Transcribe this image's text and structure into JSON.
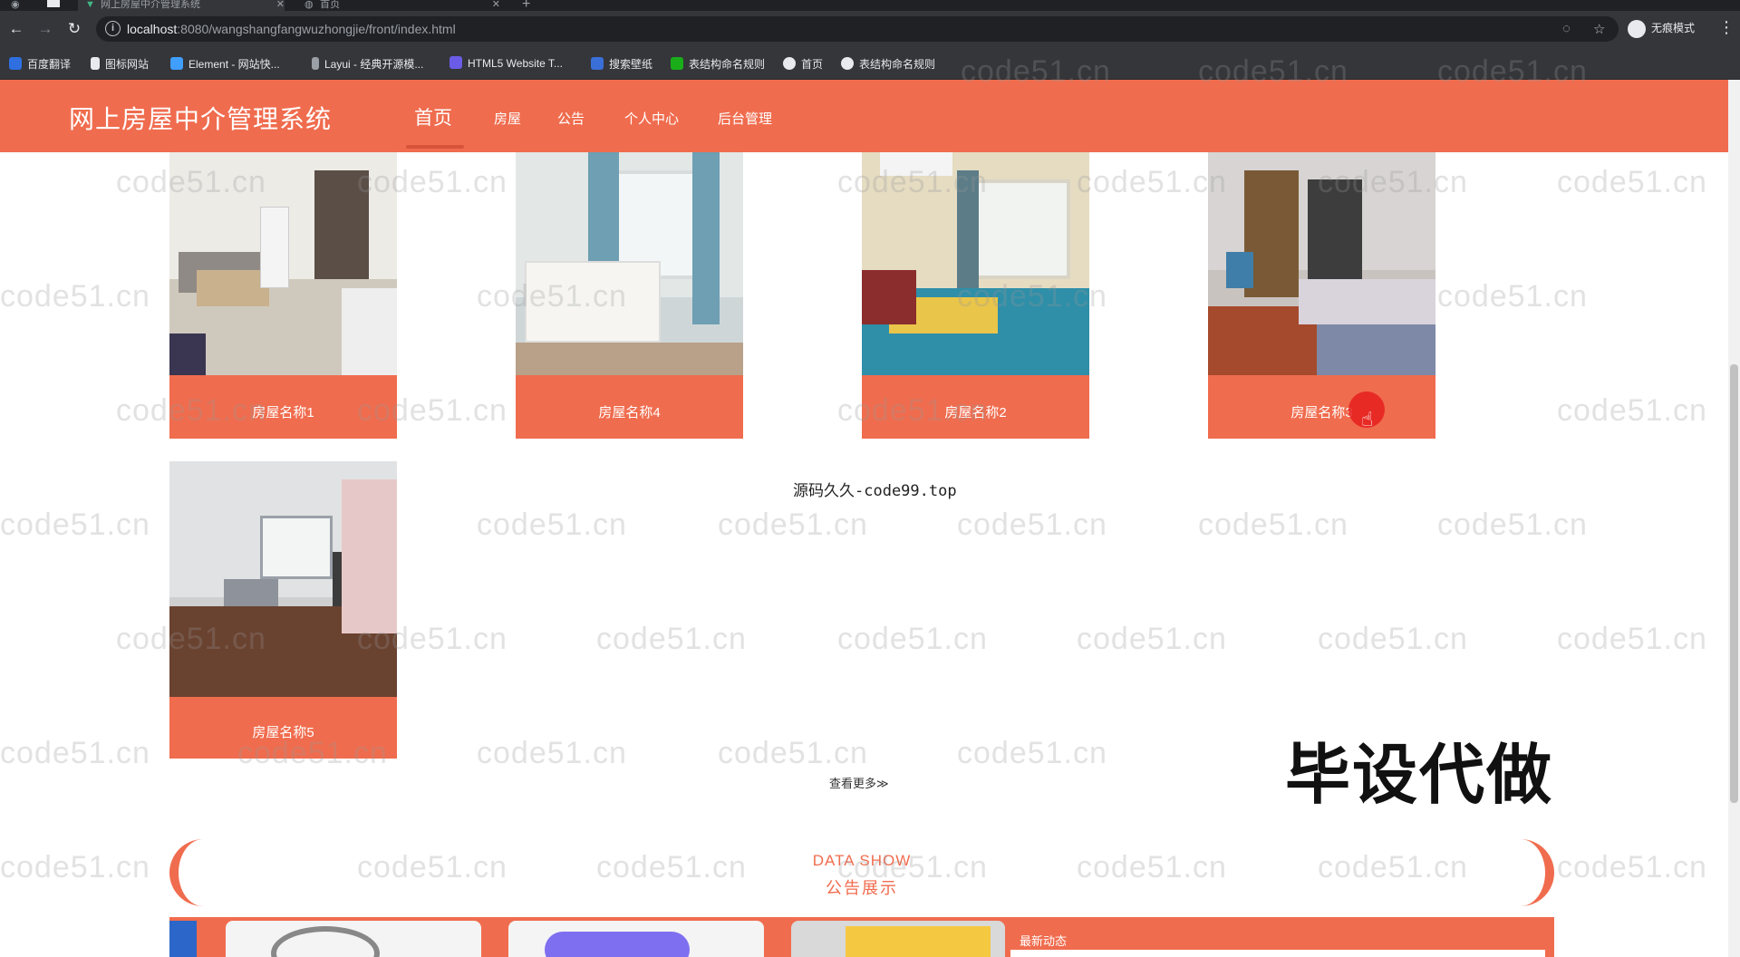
{
  "browser": {
    "tabs": [
      {
        "title": "网上房屋中介管理系统"
      },
      {
        "title": "首页"
      }
    ],
    "url_host": "localhost",
    "url_rest": ":8080/wangshangfangwuzhongjie/front/index.html",
    "profile_label": "无痕模式",
    "bookmarks": [
      {
        "label": "百度翻译",
        "color": "#2f6fe0"
      },
      {
        "label": "图标网站",
        "color": "#e8eaed"
      },
      {
        "label": "Element - 网站快...",
        "color": "#409eff"
      },
      {
        "label": "Layui - 经典开源模...",
        "color": "#9aa0a6"
      },
      {
        "label": "HTML5 Website T...",
        "color": "#6b5ce7"
      },
      {
        "label": "搜索壁纸",
        "color": "#3b6fd8"
      },
      {
        "label": "表结构命名规则",
        "color": "#1aad19"
      },
      {
        "label": "首页",
        "color": "#e8eaed"
      },
      {
        "label": "表结构命名规则",
        "color": "#e8eaed"
      }
    ]
  },
  "site": {
    "title": "网上房屋中介管理系统",
    "nav": [
      {
        "label": "首页"
      },
      {
        "label": "房屋"
      },
      {
        "label": "公告"
      },
      {
        "label": "个人中心"
      },
      {
        "label": "后台管理"
      }
    ]
  },
  "houses": [
    {
      "name": "房屋名称1"
    },
    {
      "name": "房屋名称4"
    },
    {
      "name": "房屋名称2"
    },
    {
      "name": "房屋名称3"
    },
    {
      "name": "房屋名称5"
    }
  ],
  "overlay_text": "源码久久-code99.top",
  "more_link": "查看更多≫",
  "stamp_text": "毕设代做",
  "banner": {
    "en": "DATA SHOW",
    "cn": "公告展示"
  },
  "latest_title": "最新动态",
  "watermark": "code51.cn"
}
